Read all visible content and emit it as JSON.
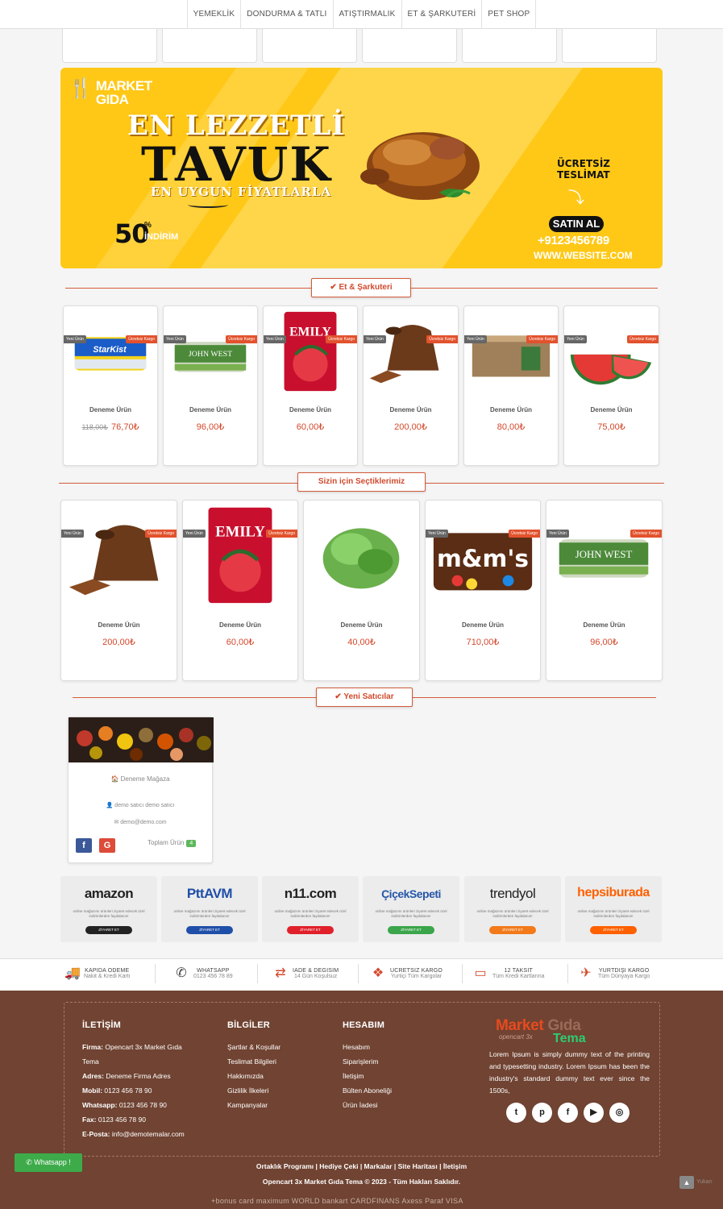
{
  "nav": {
    "items": [
      "YEMEKLİK",
      "DONDURMA & TATLI",
      "ATIŞTIRMALIK",
      "ET & ŞARKUTERİ",
      "PET SHOP"
    ]
  },
  "banner": {
    "logo_line1": "MARKET",
    "logo_line2": "GIDA",
    "line1": "EN LEZZETLİ",
    "line2": "TAVUK",
    "line3": "EN UYGUN FİYATLARLA",
    "pct": "50",
    "pct_sign": "%",
    "discount": "İNDİRİM",
    "free1": "ÜCRETSİZ",
    "free2": "TESLİMAT",
    "buy": "SATIN AL",
    "phone": "+9123456789",
    "web": "WWW.WEBSITE.COM"
  },
  "section1": {
    "title": "✔ Et & Şarkuteri",
    "products": [
      {
        "name": "Deneme Ürün",
        "old": "118,00₺",
        "price": "76,70₺",
        "badge_l": "Yeni Ürün",
        "badge_r": "Ücretsiz Kargo"
      },
      {
        "name": "Deneme Ürün",
        "price": "96,00₺",
        "badge_l": "Yeni Ürün",
        "badge_r": "Ücretsiz Kargo"
      },
      {
        "name": "Deneme Ürün",
        "price": "60,00₺",
        "badge_l": "Yeni Ürün",
        "badge_r": "Ücretsiz Kargo"
      },
      {
        "name": "Deneme Ürün",
        "price": "200,00₺",
        "badge_l": "Yeni Ürün",
        "badge_r": "Ücretsiz Kargo"
      },
      {
        "name": "Deneme Ürün",
        "price": "80,00₺",
        "badge_l": "Yeni Ürün",
        "badge_r": "Ücretsiz Kargo"
      },
      {
        "name": "Deneme Ürün",
        "price": "75,00₺",
        "badge_l": "Yeni Ürün",
        "badge_r": "Ücretsiz Kargo"
      }
    ]
  },
  "section2": {
    "title": "Sizin için Seçtiklerimiz",
    "products": [
      {
        "name": "Deneme Ürün",
        "price": "200,00₺",
        "badge_l": "Yeni Ürün",
        "badge_r": "Ücretsiz Kargo"
      },
      {
        "name": "Deneme Ürün",
        "price": "60,00₺",
        "badge_l": "Yeni Ürün",
        "badge_r": "Ücretsiz Kargo"
      },
      {
        "name": "Deneme Ürün",
        "price": "40,00₺"
      },
      {
        "name": "Deneme Ürün",
        "price": "710,00₺",
        "badge_l": "Yeni Ürün",
        "badge_r": "Ücretsiz Kargo"
      },
      {
        "name": "Deneme Ürün",
        "price": "96,00₺",
        "badge_l": "Yeni Ürün",
        "badge_r": "Ücretsiz Kargo"
      }
    ]
  },
  "section3": {
    "title": "✔ Yeni Satıcılar",
    "seller": {
      "store": "Deneme Mağaza",
      "person": "demo satıcı demo satıcı",
      "email": "demo@demo.com",
      "total_label": "Toplam Ürün",
      "total": "4",
      "fb": "f",
      "gp": "G"
    }
  },
  "stores": [
    {
      "name": "amazon",
      "color": "#222222",
      "btn": "#222222",
      "desc": "online mağazımı ürünleri ziyaret edecek özel indirimlerden faydalanın!",
      "btn_label": "ZİYARET ET"
    },
    {
      "name": "PttAVM",
      "color": "#1f4fa8",
      "btn": "#1f4fa8",
      "desc": "online mağazımı ürünleri ziyaret edecek özel indirimlerden faydalanın!",
      "btn_label": "ZİYARET ET"
    },
    {
      "name": "n11.com",
      "color": "#222222",
      "btn": "#e0202a",
      "desc": "online mağazımı ürünleri ziyaret edecek özel indirimlerden faydalanın!",
      "btn_label": "ZİYARET ET"
    },
    {
      "name": "ÇiçekSepeti",
      "color": "#2556a8",
      "btn": "#3aa54a",
      "desc": "online mağazımı ürünleri ziyaret edecek özel indirimlerden faydalanın!",
      "btn_label": "ZİYARET ET"
    },
    {
      "name": "trendyol",
      "color": "#222222",
      "btn": "#f27a1a",
      "desc": "online mağazımı ürünleri ziyaret edecek özel indirimlerden faydalanın!",
      "btn_label": "ZİYARET ET"
    },
    {
      "name": "hepsiburada",
      "color": "#ff6000",
      "btn": "#ff6000",
      "desc": "online mağazımı ürünleri ziyaret edecek özel indirimlerden faydalanın!",
      "btn_label": "ZİYARET ET"
    }
  ],
  "features": [
    {
      "icon": "truck-icon",
      "t1": "KAPIDA ODEME",
      "t2": "Nakit & Kredi Kartı"
    },
    {
      "icon": "whatsapp-icon",
      "t1": "WHATSAPP",
      "t2": "0123 456 78 89"
    },
    {
      "icon": "exchange-icon",
      "t1": "IADE & DEGISIM",
      "t2": "14 Gün Koşulsuz"
    },
    {
      "icon": "dropbox-icon",
      "t1": "UCRETSIZ KARGO",
      "t2": "Yurtiçi Tüm Kargolar"
    },
    {
      "icon": "credit-card-icon",
      "t1": "12 TAKSIT",
      "t2": "Tüm Kredi Kartlarına"
    },
    {
      "icon": "plane-icon",
      "t1": "YURTDIŞI KARGO",
      "t2": "Tüm Dünyaya Kargo"
    }
  ],
  "footer": {
    "contact_title": "İLETİŞİM",
    "firma_label": "Firma:",
    "firma_value": "Opencart 3x Market Gıda",
    "firma_value2": "Tema",
    "adres_label": "Adres:",
    "adres_value": "Deneme Firma Adres",
    "mobil_label": "Mobil:",
    "mobil_value": "0123 456 78 90",
    "whatsapp_label": "Whatsapp:",
    "whatsapp_value": "0123 456 78 90",
    "fax_label": "Fax:",
    "fax_value": "0123 456 78 90",
    "eposta_label": "E-Posta:",
    "eposta_value": "info@demotemalar.com",
    "info_title": "BİLGİLER",
    "info_links": [
      "Şartlar & Koşullar",
      "Teslimat Bilgileri",
      "Hakkımızda",
      "Gizlilik İlkeleri",
      "Kampanyalar"
    ],
    "account_title": "HESABIM",
    "account_links": [
      "Hesabım",
      "Siparişlerim",
      "İletişim",
      "Bülten Aboneliği",
      "Ürün İadesi"
    ],
    "brand1": "Market",
    "brand2": "Gıda",
    "brand3": "opencart 3x",
    "brand4": "Tema",
    "lorem": "Lorem Ipsum is simply dummy text of the printing and typesetting industry. Lorem Ipsum has been the industry's standard dummy text ever since the 1500s,",
    "bottom_links": "Ortaklık Programı | Hediye Çeki | Markalar | Site Haritası | İletişim",
    "copyright": "Opencart 3x Market Gıda Tema © 2023 - Tüm Hakları Saklıdır.",
    "payments": "+bonus card  maximum  WORLD  bankart  CARDFINANS  Axess  Paraf  VISA",
    "whatsapp_btn": "✆ Whatsapp !",
    "up_label": "Yukarı"
  }
}
